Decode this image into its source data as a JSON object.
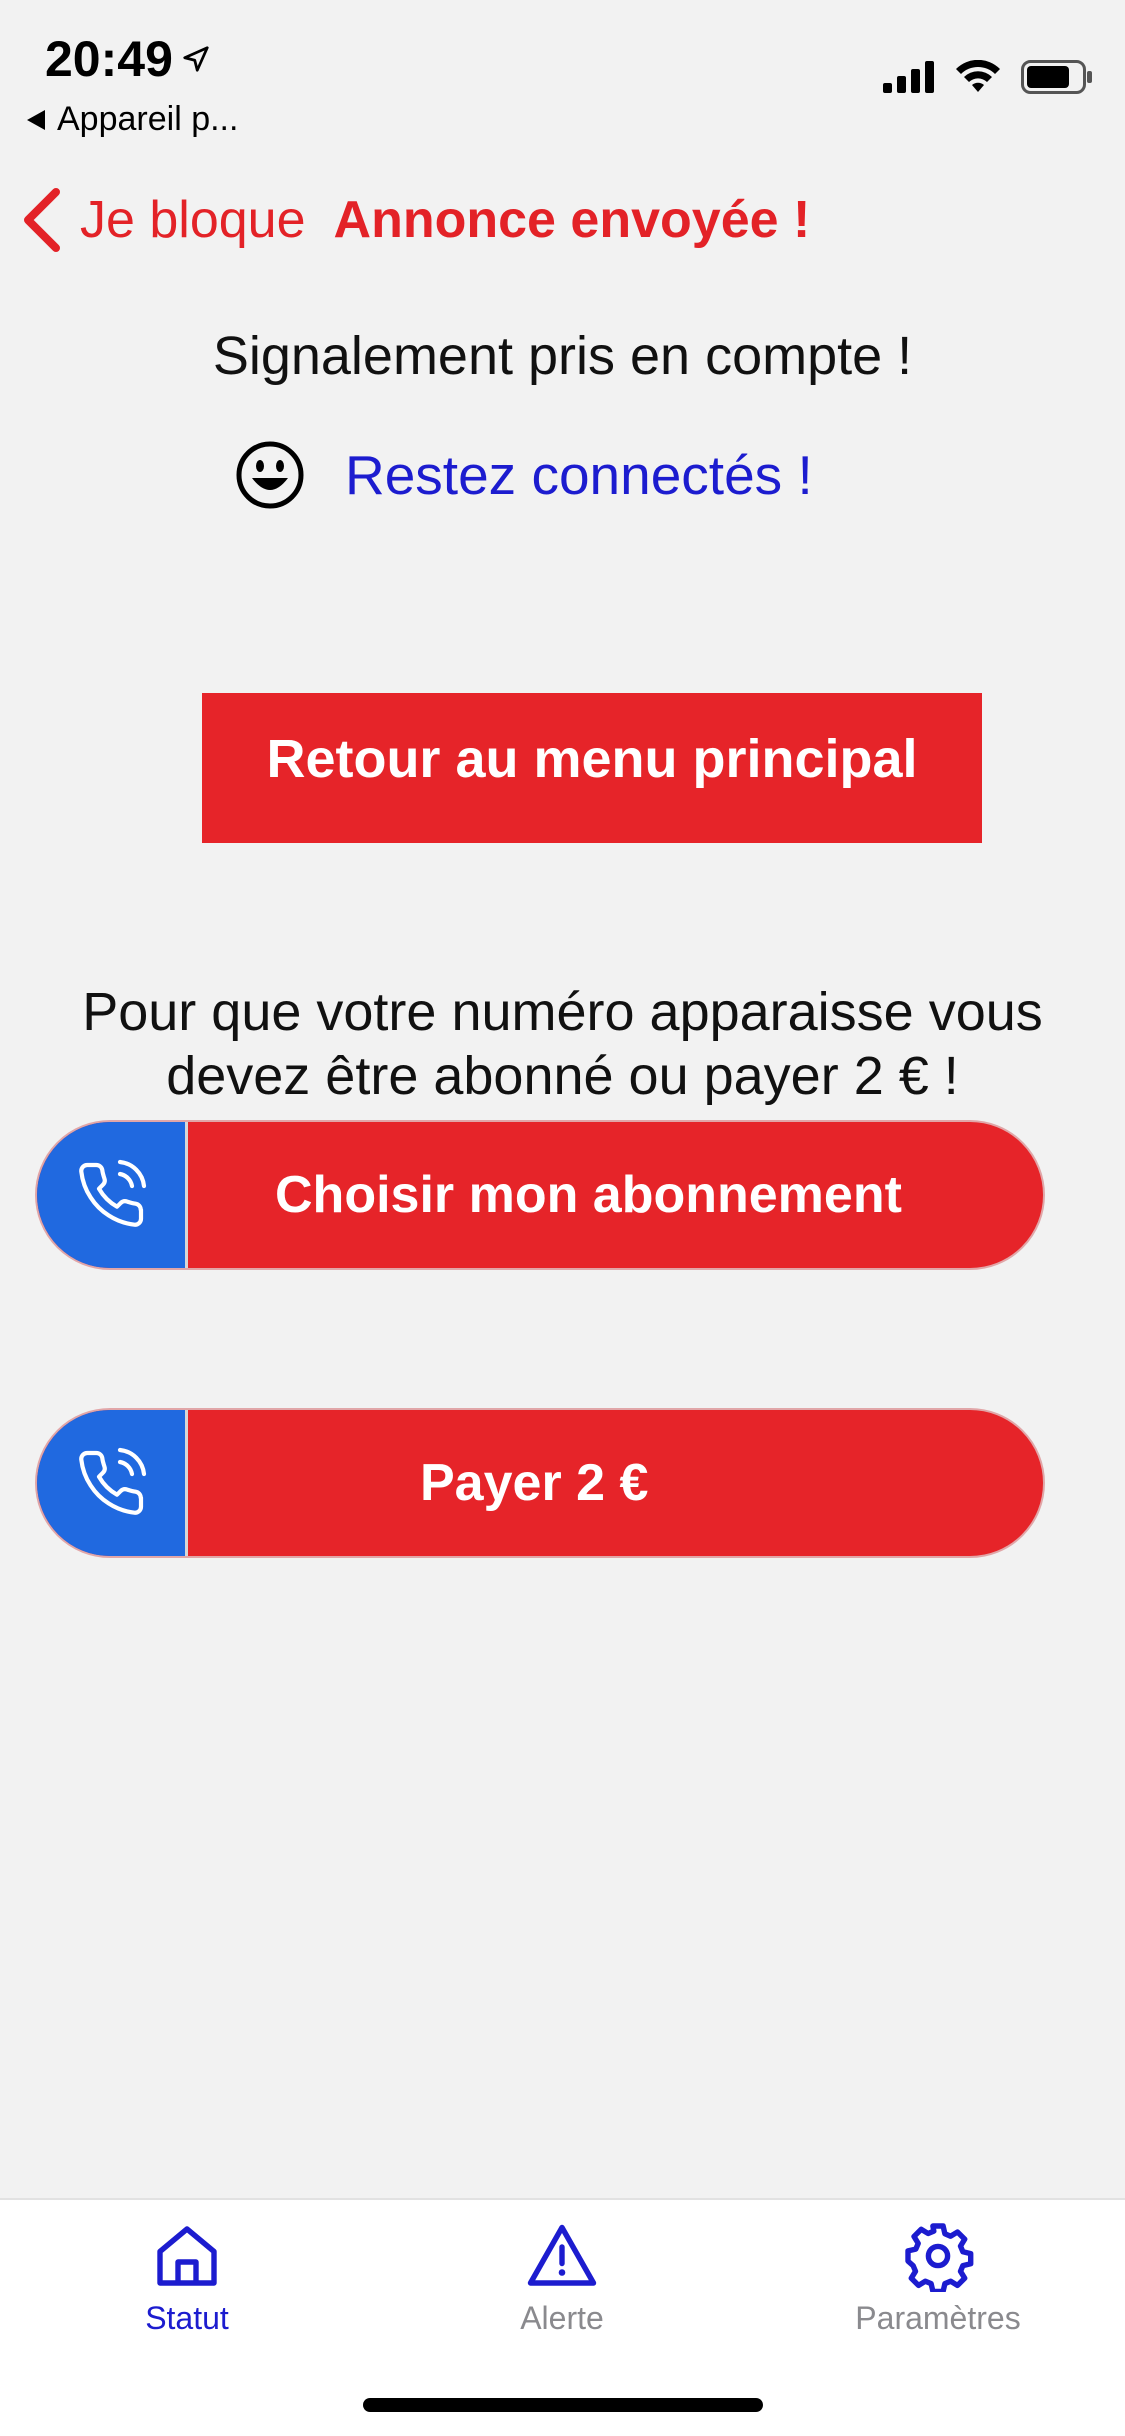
{
  "status_bar": {
    "time": "20:49",
    "back_app": "Appareil p..."
  },
  "nav": {
    "back_label": "Je bloque",
    "title": "Annonce envoyée !"
  },
  "main": {
    "confirmation": "Signalement pris en compte !",
    "stay_connected": "Restez connectés !",
    "menu_button": "Retour au menu principal",
    "info_line1": "Pour que votre numéro apparaisse vous",
    "info_line2": "devez être abonné ou payer 2 € !",
    "subscribe_button": "Choisir mon abonnement",
    "pay_button": "Payer 2 €"
  },
  "tabs": [
    {
      "label": "Statut",
      "icon": "home-icon",
      "active": true
    },
    {
      "label": "Alerte",
      "icon": "warning-icon",
      "active": false
    },
    {
      "label": "Paramètres",
      "icon": "gear-icon",
      "active": false
    }
  ],
  "colors": {
    "accent_red": "#e62429",
    "phone_blue": "#2069e0",
    "link_blue": "#1c1ccf",
    "background": "#f2f2f2"
  }
}
